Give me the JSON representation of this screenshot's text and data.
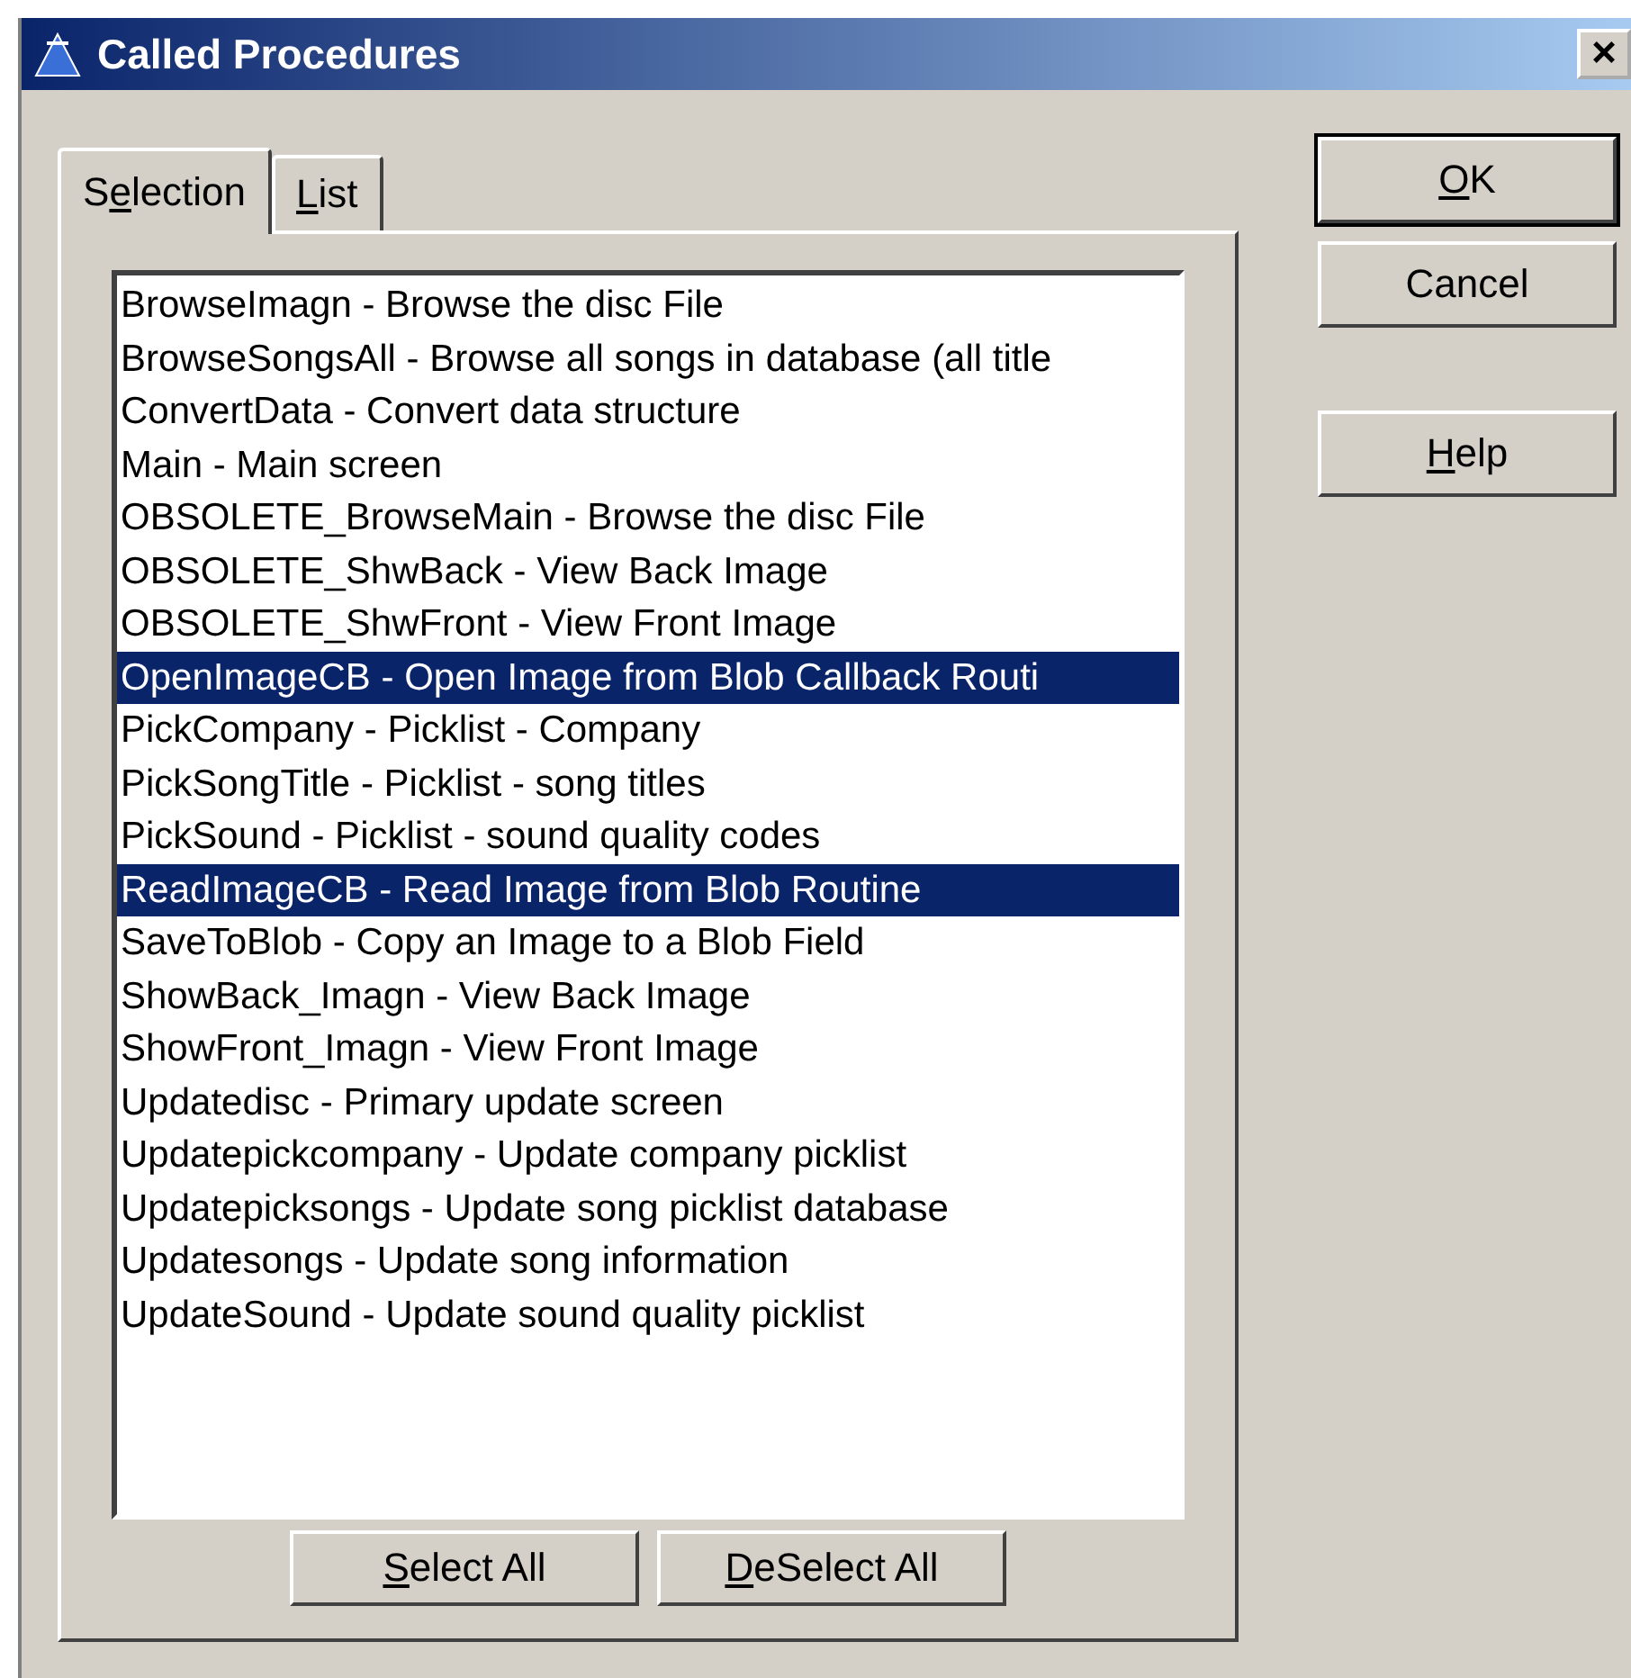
{
  "window": {
    "title": "Called Procedures",
    "close_glyph": "×"
  },
  "tabs": [
    {
      "label": {
        "before": "S",
        "key": "e",
        "after": "lection"
      },
      "selected": true
    },
    {
      "label": {
        "key": "L",
        "after": "ist"
      },
      "selected": false
    }
  ],
  "procedures": [
    {
      "text": "BrowseImagn - Browse the disc File",
      "selected": false
    },
    {
      "text": "BrowseSongsAll - Browse all songs in database (all title",
      "selected": false
    },
    {
      "text": "ConvertData - Convert data structure",
      "selected": false
    },
    {
      "text": "Main - Main screen",
      "selected": false
    },
    {
      "text": "OBSOLETE_BrowseMain - Browse the disc File",
      "selected": false
    },
    {
      "text": "OBSOLETE_ShwBack - View Back Image",
      "selected": false
    },
    {
      "text": "OBSOLETE_ShwFront - View Front Image",
      "selected": false
    },
    {
      "text": "OpenImageCB - Open Image from Blob Callback Routi",
      "selected": true
    },
    {
      "text": "PickCompany - Picklist - Company",
      "selected": false
    },
    {
      "text": "PickSongTitle - Picklist - song titles",
      "selected": false
    },
    {
      "text": "PickSound - Picklist - sound quality codes",
      "selected": false
    },
    {
      "text": "ReadImageCB - Read Image from Blob Routine",
      "selected": true
    },
    {
      "text": "SaveToBlob - Copy an Image to a Blob Field",
      "selected": false
    },
    {
      "text": "ShowBack_Imagn - View Back Image",
      "selected": false
    },
    {
      "text": "ShowFront_Imagn - View Front Image",
      "selected": false
    },
    {
      "text": "Updatedisc - Primary update screen",
      "selected": false
    },
    {
      "text": "Updatepickcompany - Update company picklist",
      "selected": false
    },
    {
      "text": "Updatepicksongs - Update song picklist database",
      "selected": false
    },
    {
      "text": "Updatesongs - Update song information",
      "selected": false
    },
    {
      "text": "UpdateSound - Update sound quality picklist",
      "selected": false
    }
  ],
  "list_buttons": [
    {
      "label": {
        "key": "S",
        "after": "elect All"
      }
    },
    {
      "label": {
        "key": "D",
        "after": "eSelect All"
      }
    }
  ],
  "dialog_buttons": [
    {
      "label": {
        "key": "O",
        "after": "K"
      },
      "default": true
    },
    {
      "label": {
        "after": "Cancel"
      },
      "default": false
    },
    {
      "label": {
        "key": "H",
        "after": "elp"
      },
      "default": false
    }
  ]
}
